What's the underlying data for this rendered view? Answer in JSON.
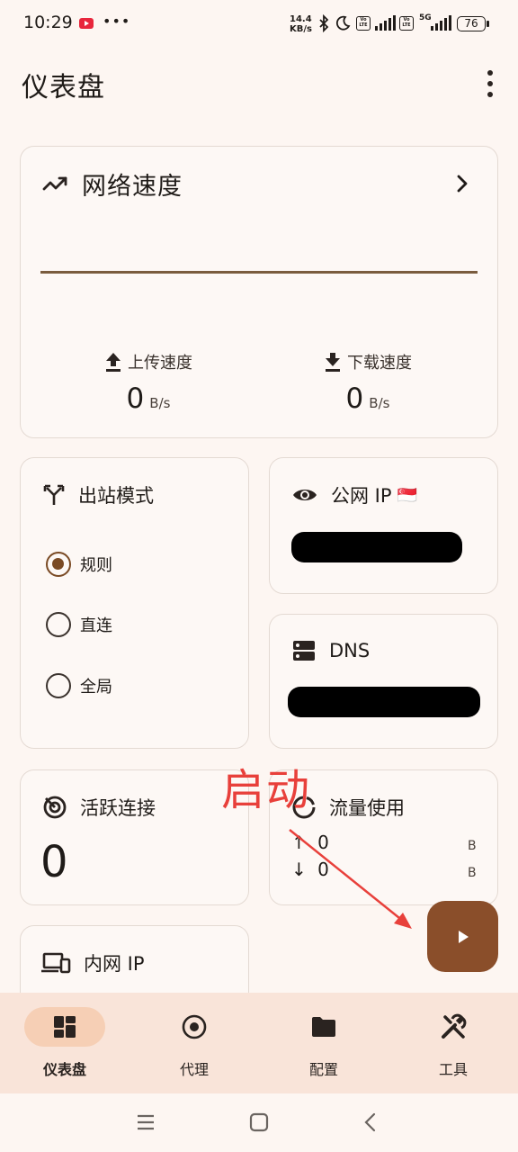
{
  "status_bar": {
    "time": "10:29",
    "more": "•••",
    "net_speed_top": "14.4",
    "net_speed_bottom": "KB/s",
    "volte1": "Vo LTE",
    "volte2": "Vo LTE",
    "five_g": "5G",
    "battery": "76"
  },
  "header": {
    "title": "仪表盘"
  },
  "network_speed": {
    "title": "网络速度",
    "upload_label": "上传速度",
    "upload_value": "0",
    "upload_unit": "B/s",
    "download_label": "下载速度",
    "download_value": "0",
    "download_unit": "B/s"
  },
  "outbound_mode": {
    "title": "出站模式",
    "options": [
      {
        "label": "规则",
        "selected": true
      },
      {
        "label": "直连",
        "selected": false
      },
      {
        "label": "全局",
        "selected": false
      }
    ]
  },
  "public_ip": {
    "title": "公网 IP",
    "flag": "🇸🇬"
  },
  "dns": {
    "title": "DNS"
  },
  "active_connections": {
    "title": "活跃连接",
    "value": "0"
  },
  "traffic": {
    "title": "流量使用",
    "up_arrow": "↑",
    "up_value": "0",
    "up_unit": "B",
    "down_arrow": "↓",
    "down_value": "0",
    "down_unit": "B"
  },
  "intranet_ip": {
    "title": "内网 IP"
  },
  "annotation": {
    "text": "启动",
    "color": "#E8403B"
  },
  "bottom_nav": {
    "items": [
      {
        "label": "仪表盘",
        "icon": "dashboard-icon",
        "active": true
      },
      {
        "label": "代理",
        "icon": "radio-button-icon",
        "active": false
      },
      {
        "label": "配置",
        "icon": "folder-icon",
        "active": false
      },
      {
        "label": "工具",
        "icon": "tools-icon",
        "active": false
      }
    ]
  },
  "colors": {
    "accent": "#8A4E2A",
    "background": "#FDF6F2",
    "nav_bg": "#F9E4D9",
    "nav_active": "#F6CFB5"
  }
}
